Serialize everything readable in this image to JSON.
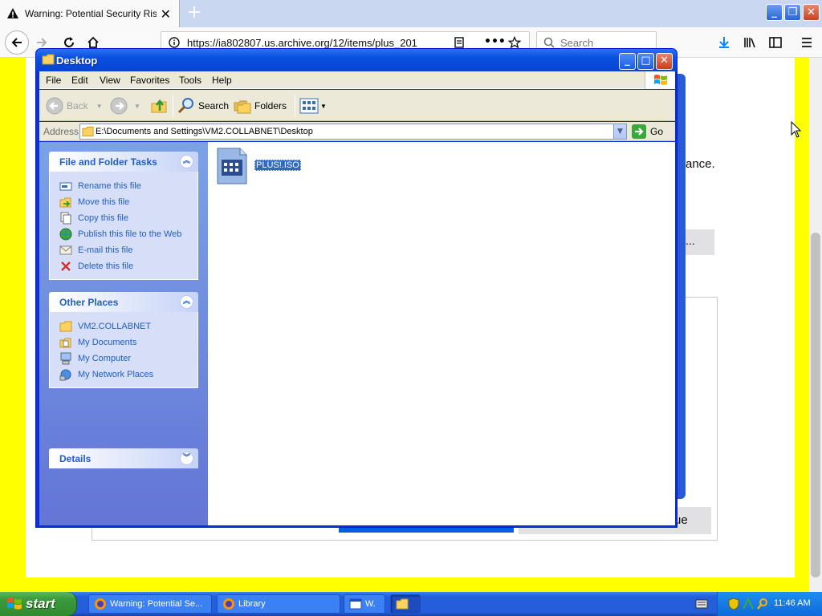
{
  "firefox": {
    "tab_title": "Warning: Potential Security Risk Ahead",
    "url": "https://ia802807.us.archive.org/12/items/plus_201",
    "search_placeholder": "Search"
  },
  "background_page": {
    "text_fragment": "ance.",
    "button_fragment": "...",
    "continue_fragment": "ue"
  },
  "explorer": {
    "title": "Desktop",
    "menu": [
      "File",
      "Edit",
      "View",
      "Favorites",
      "Tools",
      "Help"
    ],
    "toolbar": {
      "back": "Back",
      "search": "Search",
      "folders": "Folders"
    },
    "address_label": "Address",
    "address_path": "E:\\Documents and Settings\\VM2.COLLABNET\\Desktop",
    "go_label": "Go",
    "task_pane": {
      "file_tasks": {
        "title": "File and Folder Tasks",
        "items": [
          "Rename this file",
          "Move this file",
          "Copy this file",
          "Publish this file to the Web",
          "E-mail this file",
          "Delete this file"
        ]
      },
      "other_places": {
        "title": "Other Places",
        "items": [
          "VM2.COLLABNET",
          "My Documents",
          "My Computer",
          "My Network Places"
        ]
      },
      "details": {
        "title": "Details"
      }
    },
    "files": [
      {
        "name": "PLUS!.ISO",
        "selected": true
      }
    ]
  },
  "taskbar": {
    "start_label": "start",
    "tasks": [
      {
        "label": "Warning: Potential Se...",
        "active": false
      },
      {
        "label": "Library",
        "active": false
      },
      {
        "label": "W.",
        "active": false
      },
      {
        "label": "",
        "active": true
      }
    ],
    "clock": "11:46 AM"
  },
  "colors": {
    "xp_blue": "#0831d9",
    "taskpane_link": "#215dc6",
    "selection": "#316ac5",
    "page_yellow": "#ffff00"
  }
}
